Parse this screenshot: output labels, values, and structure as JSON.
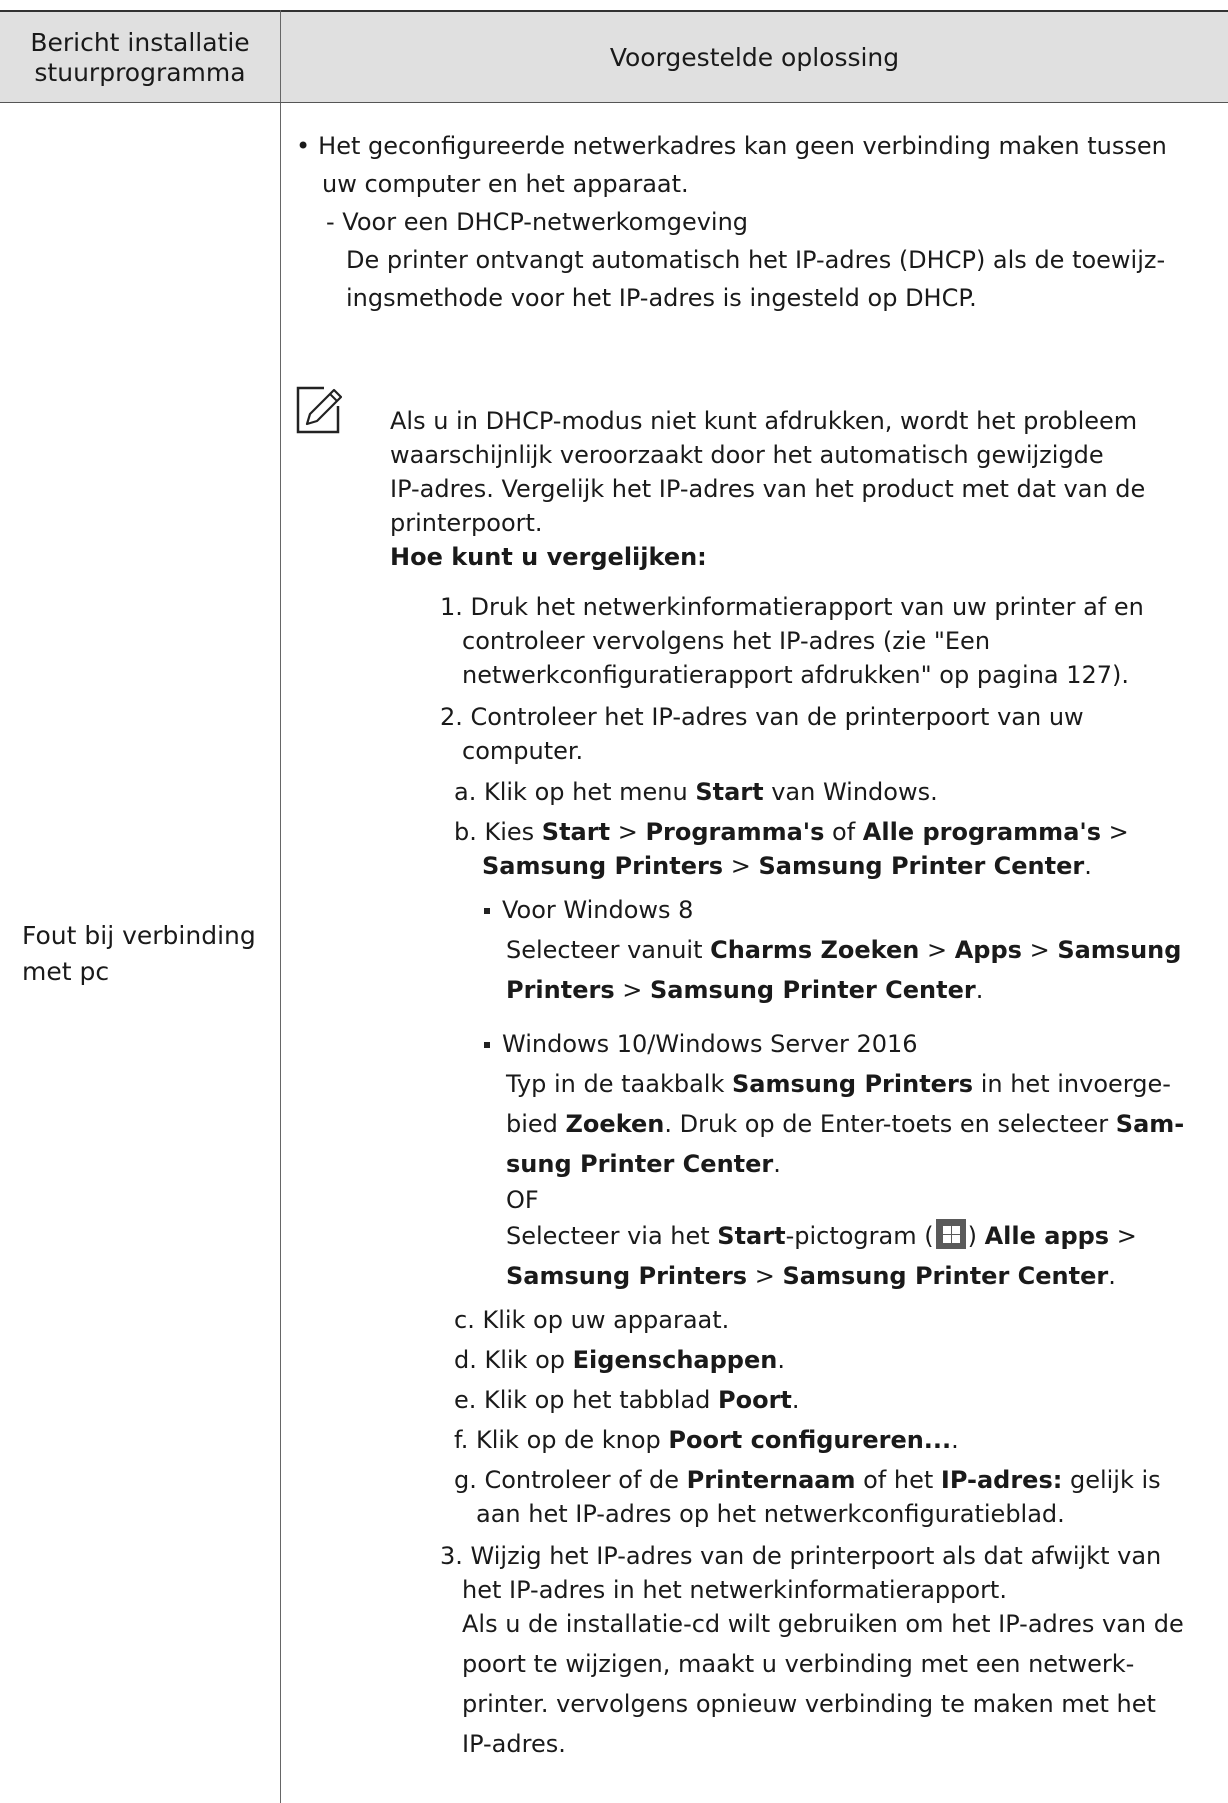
{
  "header": {
    "col1_line1": "Bericht installatie",
    "col1_line2": "stuurprogramma",
    "col2": "Voorgestelde oplossing"
  },
  "row": {
    "label_line1": "Fout bij verbinding",
    "label_line2": "met pc"
  },
  "solution": {
    "bullet_line1": "Het geconfigureerde netwerkadres kan geen verbinding maken tussen",
    "bullet_line2": "uw computer en het apparaat.",
    "dash_item": "- Voor een DHCP-netwerkomgeving",
    "dhcp_line1": "De printer ontvangt automatisch het IP-adres (DHCP) als de toewijz-",
    "dhcp_line2": "ingsmethode voor het IP-adres is ingesteld op DHCP."
  },
  "note": {
    "icon": "note-pencil-icon",
    "line1": "Als u in DHCP-modus niet kunt afdrukken, wordt het probleem",
    "line2": "waarschijnlijk veroorzaakt door het automatisch gewijzigde",
    "line3": "IP-adres. Vergelijk het IP-adres van het product met dat van de",
    "line4": "printerpoort.",
    "heading": "Hoe kunt u vergelijken:"
  },
  "steps": {
    "s1_line1": "1. Druk het netwerkinformatierapport van uw printer af en",
    "s1_line2": "controleer vervolgens het IP-adres (zie \"Een",
    "s1_line3": "netwerkconfiguratierapport afdrukken\" op pagina 127).",
    "s2_line1": "2. Controleer het IP-adres van de printerpoort van uw",
    "s2_line2": "computer.",
    "a_pre": "a. Klik op het menu ",
    "a_bold": "Start",
    "a_post": " van Windows.",
    "b_pre": "b. Kies ",
    "b_start": "Start",
    "b_sep1": " > ",
    "b_programs": "Programma's",
    "b_or": " of ",
    "b_allprograms": "Alle programma's",
    "b_sep2": " >",
    "b2_printers": "Samsung Printers",
    "b2_sep": " > ",
    "b2_center": "Samsung Printer Center",
    "b2_end": ".",
    "w8_title": "Voor Windows 8",
    "w8_pre": "Selecteer vanuit ",
    "w8_charms": "Charms Zoeken",
    "w8_sep1": " > ",
    "w8_apps": "Apps",
    "w8_sep2": " > ",
    "w8_samsung": "Samsung",
    "w8b_printers": "Printers",
    "w8b_sep": " > ",
    "w8b_center": "Samsung Printer Center",
    "w8b_end": ".",
    "w10_title": "Windows 10/Windows Server 2016",
    "w10_pre": "Typ in de taakbalk ",
    "w10_printers": "Samsung Printers",
    "w10_post": " in het invoerge-",
    "w10b_pre": "bied ",
    "w10b_zoeken": "Zoeken",
    "w10b_post": ". Druk op de Enter-toets en selecteer ",
    "w10b_sam": "Sam-",
    "w10c_sung": "sung Printer Center",
    "w10c_end": ".",
    "w10_of": "OF",
    "w10d_pre": "Selecteer via het ",
    "w10d_start": "Start",
    "w10d_mid": "-pictogram (",
    "w10d_close": ") ",
    "w10d_allapps": "Alle apps",
    "w10d_sep": " >",
    "w10e_printers": "Samsung Printers",
    "w10e_sep": " > ",
    "w10e_center": "Samsung Printer Center",
    "w10e_end": ".",
    "c_text": "c. Klik op uw apparaat.",
    "d_pre": "d. Klik op ",
    "d_bold": "Eigenschappen",
    "d_end": ".",
    "e_pre": "e. Klik op het tabblad ",
    "e_bold": "Poort",
    "e_end": ".",
    "f_pre": "f. Klik op de knop ",
    "f_bold": "Poort configureren...",
    "f_end": ".",
    "g_pre": "g. Controleer of de ",
    "g_name": "Printernaam",
    "g_mid": " of het ",
    "g_ip": "IP-adres:",
    "g_post": " gelijk is",
    "g2_text": "aan het IP-adres op het netwerkconfiguratieblad.",
    "s3_line1": "3. Wijzig het IP-adres van de printerpoort als dat afwijkt van",
    "s3_line2": "het IP-adres in het netwerkinformatierapport.",
    "s3_line3": "Als u de installatie-cd wilt gebruiken om het IP-adres van de",
    "s3_line4": "poort te wijzigen, maakt u verbinding met een netwerk-",
    "s3_line5": "printer. vervolgens opnieuw verbinding te maken met het",
    "s3_line6": "IP-adres."
  }
}
